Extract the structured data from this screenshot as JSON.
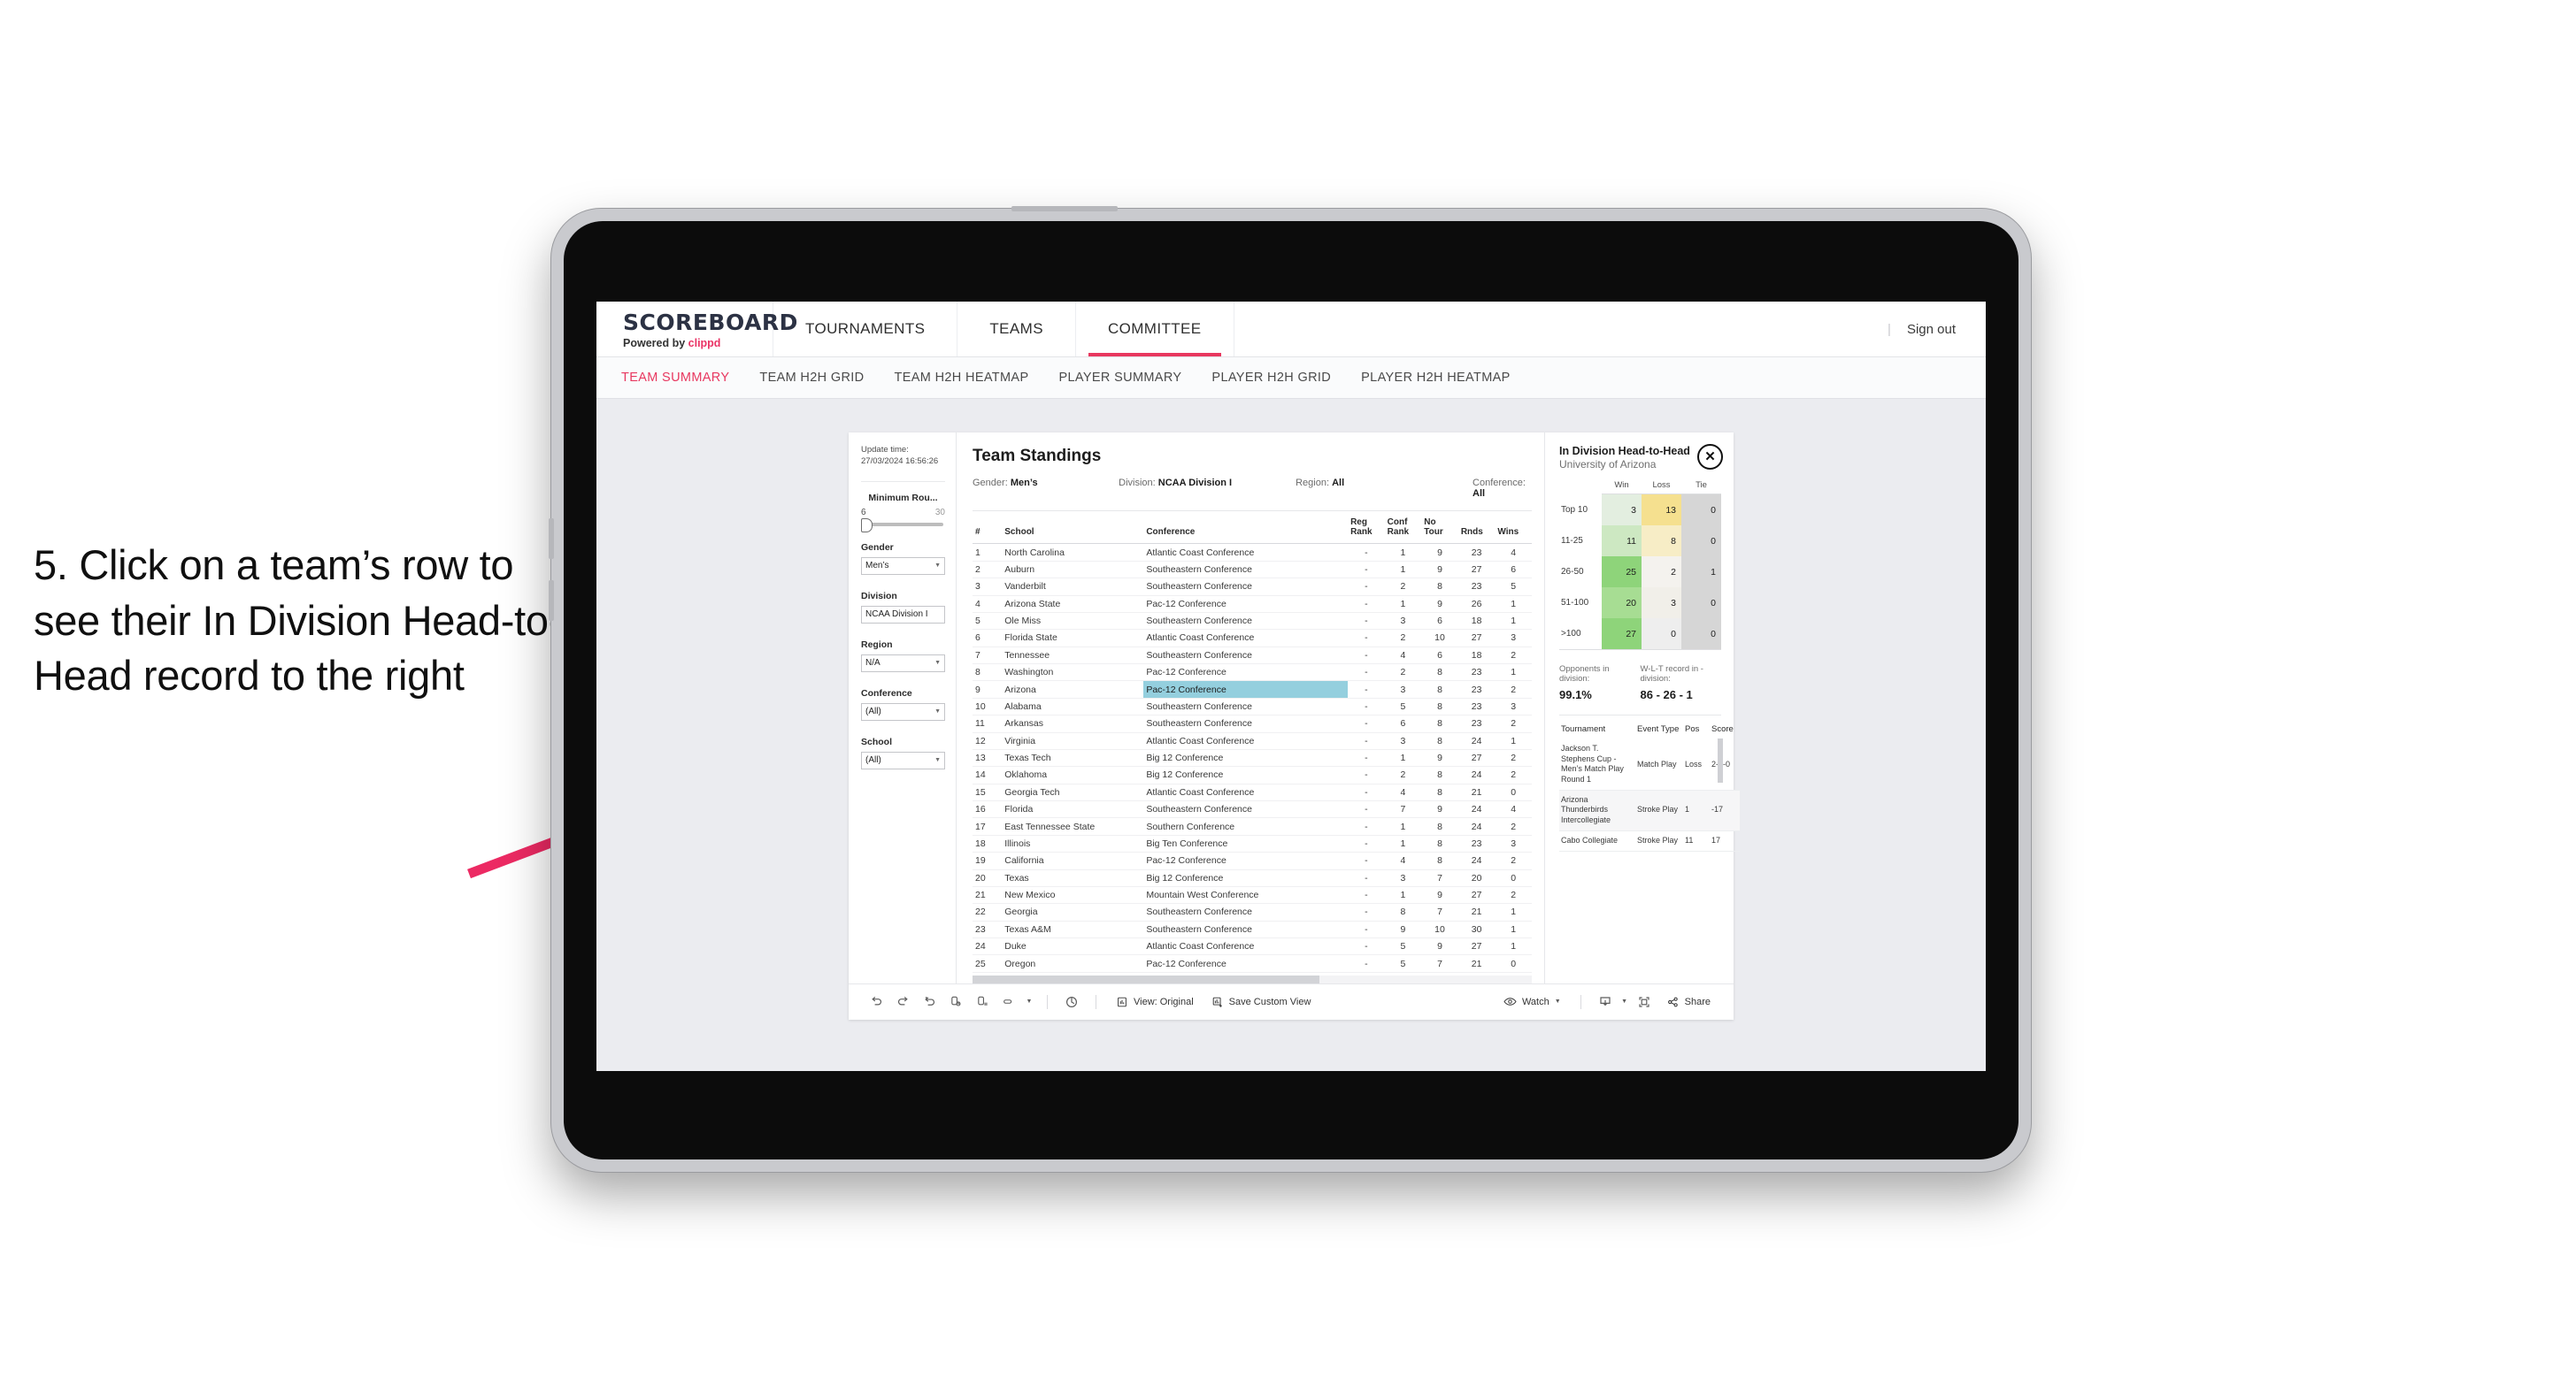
{
  "annotation": {
    "text": "5. Click on a team’s row to see their In Division Head-to-Head record to the right",
    "arrow_color": "#ec2a63"
  },
  "app": {
    "brand": {
      "name": "SCOREBOARD",
      "powered_prefix": "Powered by ",
      "powered_brand": "clippd"
    },
    "top_nav": [
      {
        "label": "TOURNAMENTS",
        "active": false
      },
      {
        "label": "TEAMS",
        "active": false
      },
      {
        "label": "COMMITTEE",
        "active": true
      }
    ],
    "sign_out": "Sign out",
    "divider": "|",
    "sub_nav": [
      {
        "label": "TEAM SUMMARY",
        "active": true
      },
      {
        "label": "TEAM H2H GRID",
        "active": false
      },
      {
        "label": "TEAM H2H HEATMAP",
        "active": false
      },
      {
        "label": "PLAYER SUMMARY",
        "active": false
      },
      {
        "label": "PLAYER H2H GRID",
        "active": false
      },
      {
        "label": "PLAYER H2H HEATMAP",
        "active": false
      }
    ],
    "accent_color": "#e8375f"
  },
  "filters": {
    "update_time_label": "Update time:",
    "update_time_value": "27/03/2024 16:56:26",
    "slider": {
      "label": "Minimum Rou...",
      "min": "6",
      "max": "30"
    },
    "gender": {
      "label": "Gender",
      "value": "Men’s"
    },
    "division": {
      "label": "Division",
      "value": "NCAA Division I"
    },
    "region": {
      "label": "Region",
      "value": "N/A"
    },
    "conference": {
      "label": "Conference",
      "value": "(All)"
    },
    "school": {
      "label": "School",
      "value": "(All)"
    }
  },
  "standings": {
    "title": "Team Standings",
    "meta": {
      "gender_key": "Gender: ",
      "gender_val": "Men’s",
      "division_key": "Division: ",
      "division_val": "NCAA Division I",
      "region_key": "Region: ",
      "region_val": "All",
      "conference_key": "Conference: ",
      "conference_val": "All"
    },
    "columns": [
      "#",
      "School",
      "Conference",
      "Reg Rank",
      "Conf Rank",
      "No Tour",
      "Rnds",
      "Wins"
    ],
    "selected_row_index": 8,
    "rows": [
      [
        "1",
        "North Carolina",
        "Atlantic Coast Conference",
        "-",
        "1",
        "9",
        "23",
        "4"
      ],
      [
        "2",
        "Auburn",
        "Southeastern Conference",
        "-",
        "1",
        "9",
        "27",
        "6"
      ],
      [
        "3",
        "Vanderbilt",
        "Southeastern Conference",
        "-",
        "2",
        "8",
        "23",
        "5"
      ],
      [
        "4",
        "Arizona State",
        "Pac-12 Conference",
        "-",
        "1",
        "9",
        "26",
        "1"
      ],
      [
        "5",
        "Ole Miss",
        "Southeastern Conference",
        "-",
        "3",
        "6",
        "18",
        "1"
      ],
      [
        "6",
        "Florida State",
        "Atlantic Coast Conference",
        "-",
        "2",
        "10",
        "27",
        "3"
      ],
      [
        "7",
        "Tennessee",
        "Southeastern Conference",
        "-",
        "4",
        "6",
        "18",
        "2"
      ],
      [
        "8",
        "Washington",
        "Pac-12 Conference",
        "-",
        "2",
        "8",
        "23",
        "1"
      ],
      [
        "9",
        "Arizona",
        "Pac-12 Conference",
        "-",
        "3",
        "8",
        "23",
        "2"
      ],
      [
        "10",
        "Alabama",
        "Southeastern Conference",
        "-",
        "5",
        "8",
        "23",
        "3"
      ],
      [
        "11",
        "Arkansas",
        "Southeastern Conference",
        "-",
        "6",
        "8",
        "23",
        "2"
      ],
      [
        "12",
        "Virginia",
        "Atlantic Coast Conference",
        "-",
        "3",
        "8",
        "24",
        "1"
      ],
      [
        "13",
        "Texas Tech",
        "Big 12 Conference",
        "-",
        "1",
        "9",
        "27",
        "2"
      ],
      [
        "14",
        "Oklahoma",
        "Big 12 Conference",
        "-",
        "2",
        "8",
        "24",
        "2"
      ],
      [
        "15",
        "Georgia Tech",
        "Atlantic Coast Conference",
        "-",
        "4",
        "8",
        "21",
        "0"
      ],
      [
        "16",
        "Florida",
        "Southeastern Conference",
        "-",
        "7",
        "9",
        "24",
        "4"
      ],
      [
        "17",
        "East Tennessee State",
        "Southern Conference",
        "-",
        "1",
        "8",
        "24",
        "2"
      ],
      [
        "18",
        "Illinois",
        "Big Ten Conference",
        "-",
        "1",
        "8",
        "23",
        "3"
      ],
      [
        "19",
        "California",
        "Pac-12 Conference",
        "-",
        "4",
        "8",
        "24",
        "2"
      ],
      [
        "20",
        "Texas",
        "Big 12 Conference",
        "-",
        "3",
        "7",
        "20",
        "0"
      ],
      [
        "21",
        "New Mexico",
        "Mountain West Conference",
        "-",
        "1",
        "9",
        "27",
        "2"
      ],
      [
        "22",
        "Georgia",
        "Southeastern Conference",
        "-",
        "8",
        "7",
        "21",
        "1"
      ],
      [
        "23",
        "Texas A&M",
        "Southeastern Conference",
        "-",
        "9",
        "10",
        "30",
        "1"
      ],
      [
        "24",
        "Duke",
        "Atlantic Coast Conference",
        "-",
        "5",
        "9",
        "27",
        "1"
      ],
      [
        "25",
        "Oregon",
        "Pac-12 Conference",
        "-",
        "5",
        "7",
        "21",
        "0"
      ]
    ]
  },
  "h2h": {
    "title": "In Division Head-to-Head",
    "subtitle": "University of Arizona",
    "close_icon": "✕",
    "matrix": {
      "columns": [
        "Win",
        "Loss",
        "Tie"
      ],
      "rows": [
        {
          "label": "Top 10",
          "win": "3",
          "loss": "13",
          "tie": "0",
          "win_color": "#e3eee0",
          "loss_color": "#f5e08f",
          "tie_color": "#d6d6d6"
        },
        {
          "label": "11-25",
          "win": "11",
          "loss": "8",
          "tie": "0",
          "win_color": "#cde8c2",
          "loss_color": "#f7edc6",
          "tie_color": "#d6d6d6"
        },
        {
          "label": "26-50",
          "win": "25",
          "loss": "2",
          "tie": "1",
          "win_color": "#8ed47a",
          "loss_color": "#f4f2ee",
          "tie_color": "#d6d6d6"
        },
        {
          "label": "51-100",
          "win": "20",
          "loss": "3",
          "tie": "0",
          "win_color": "#a7dd93",
          "loss_color": "#f1efe9",
          "tie_color": "#d6d6d6"
        },
        {
          "label": ">100",
          "win": "27",
          "loss": "0",
          "tie": "0",
          "win_color": "#8ed47a",
          "loss_color": "#eeeeee",
          "tie_color": "#d6d6d6"
        }
      ]
    },
    "stats": [
      {
        "key": "Opponents in division:",
        "value": "99.1%"
      },
      {
        "key": "W-L-T record in -division:",
        "value": "86 - 26 - 1"
      }
    ],
    "tournaments": {
      "columns": [
        "Tournament",
        "Event Type",
        "Pos",
        "Score"
      ],
      "rows": [
        [
          "Jackson T. Stephens Cup - Men’s Match Play Round 1",
          "Match Play",
          "Loss",
          "2-3-0"
        ],
        [
          "Arizona Thunderbirds Intercollegiate",
          "Stroke Play",
          "1",
          "-17"
        ],
        [
          "Cabo Collegiate",
          "Stroke Play",
          "11",
          "17"
        ]
      ]
    }
  },
  "toolbar": {
    "undo": "undo-icon",
    "redo": "redo-icon",
    "revert": "revert-icon",
    "refresh": "refresh-data-icon",
    "pause": "pause-icon",
    "subscribe": "alerts-icon",
    "view_label": "View: Original",
    "save_label": "Save Custom View",
    "watch_label": "Watch",
    "share_label": "Share"
  }
}
